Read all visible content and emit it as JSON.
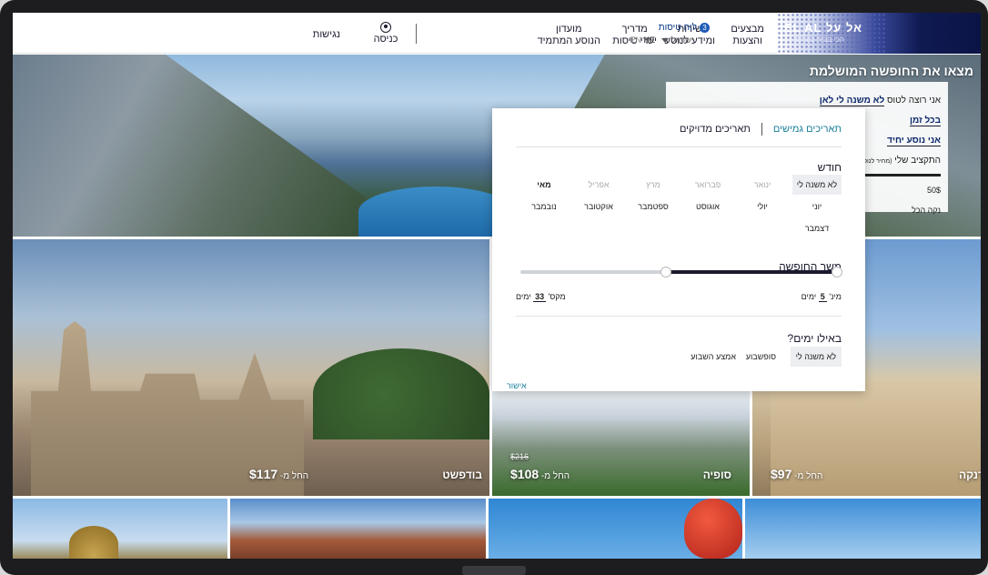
{
  "header": {
    "logo_text": "EL AL אל על",
    "logo_tagline": "הכי בבית בעולם",
    "nav": {
      "accessibility": "נגישות",
      "login": "כניסה",
      "club_line1": "מועדון",
      "club_line2": "הנוסע המתמיד",
      "guide_line1": "מדריך",
      "guide_line2": "יעדי טיסות",
      "services_line1": "שירות",
      "services_line2": "ומידע לנוסע",
      "deals_line1": "מבצעים",
      "deals_line2": "והצעות"
    },
    "flight_status": "לוח טיסות",
    "flight_status_count": "3",
    "country": "ישראל",
    "lang_he": "HE",
    "lang_en": "EN"
  },
  "hero": {
    "title": "מצאו את החופשה המושלמת",
    "card_line1_prefix": "אני רוצה לטוס",
    "card_line1_link": "לא משנה לי לאן",
    "card_line2": "בכל זמן",
    "card_line3": "אני נוסע יחיד",
    "card_line4": "התקציב שלי",
    "card_line4_note": "(מחיר לנוסע)",
    "card_price": "50$",
    "card_clear": "נקה הכל"
  },
  "popup": {
    "tab_flexible": "תאריכים גמישים",
    "tab_exact": "תאריכים מדויקים",
    "month_title": "חודש",
    "months": [
      {
        "label": "לא משנה לי",
        "state": "sel"
      },
      {
        "label": "ינואר",
        "state": "dis"
      },
      {
        "label": "פברואר",
        "state": "dis"
      },
      {
        "label": "מרץ",
        "state": "dis"
      },
      {
        "label": "אפריל",
        "state": "dis"
      },
      {
        "label": "מאי",
        "state": "normal"
      },
      {
        "label": "יוני",
        "state": "normal"
      },
      {
        "label": "יולי",
        "state": "normal"
      },
      {
        "label": "אוגוסט",
        "state": "normal"
      },
      {
        "label": "ספטמבר",
        "state": "normal"
      },
      {
        "label": "אוקטובר",
        "state": "normal"
      },
      {
        "label": "נובמבר",
        "state": "normal"
      },
      {
        "label": "דצמבר",
        "state": "normal"
      }
    ],
    "duration_title": "משך החופשה",
    "min_label": "מינ'",
    "min_value": "5",
    "max_label": "מקס'",
    "max_value": "33",
    "days_unit": "ימים",
    "which_days_title": "באילו ימים?",
    "days_options": [
      {
        "label": "לא משנה לי",
        "state": "sel"
      },
      {
        "label": "סופשבוע",
        "state": "normal"
      },
      {
        "label": "אמצע השבוע",
        "state": "normal"
      }
    ],
    "confirm": "אישור"
  },
  "tiles": {
    "budapest": {
      "name": "בודפשט",
      "from_label": "החל מ-",
      "price": "$117"
    },
    "sofia": {
      "name": "סופיה",
      "from_label": "החל מ-",
      "price": "$108",
      "old_price": "$216"
    },
    "larnaca": {
      "name": "לרנקה",
      "from_label": "החל מ-",
      "price": "$97"
    }
  }
}
